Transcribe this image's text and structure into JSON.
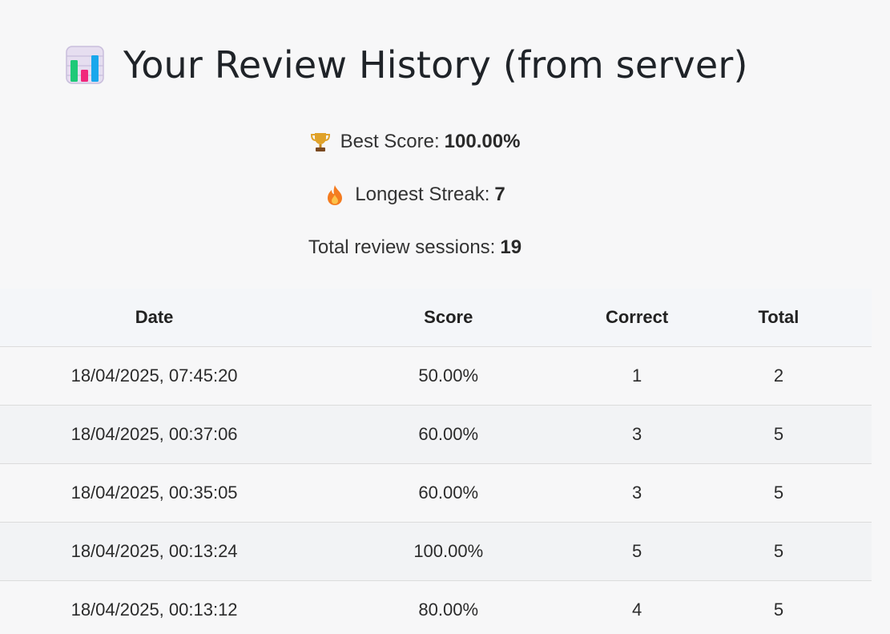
{
  "header": {
    "icon": "bar-chart-icon",
    "title": "Your Review History (from server)"
  },
  "stats": {
    "best_score": {
      "icon": "trophy-icon",
      "label": "Best Score:",
      "value": "100.00%"
    },
    "longest_streak": {
      "icon": "fire-icon",
      "label": "Longest Streak:",
      "value": "7"
    },
    "total_sessions": {
      "label": "Total review sessions:",
      "value": "19"
    }
  },
  "table": {
    "columns": [
      "Date",
      "Score",
      "Correct",
      "Total"
    ],
    "rows": [
      {
        "date": "18/04/2025, 07:45:20",
        "score": "50.00%",
        "correct": "1",
        "total": "2"
      },
      {
        "date": "18/04/2025, 00:37:06",
        "score": "60.00%",
        "correct": "3",
        "total": "5"
      },
      {
        "date": "18/04/2025, 00:35:05",
        "score": "60.00%",
        "correct": "3",
        "total": "5"
      },
      {
        "date": "18/04/2025, 00:13:24",
        "score": "100.00%",
        "correct": "5",
        "total": "5"
      },
      {
        "date": "18/04/2025, 00:13:12",
        "score": "80.00%",
        "correct": "4",
        "total": "5"
      }
    ]
  },
  "colors": {
    "background": "#f7f7f8",
    "header_row": "#f4f6f9",
    "row_alt": "#f2f3f5",
    "divider": "#dcdcdc"
  }
}
